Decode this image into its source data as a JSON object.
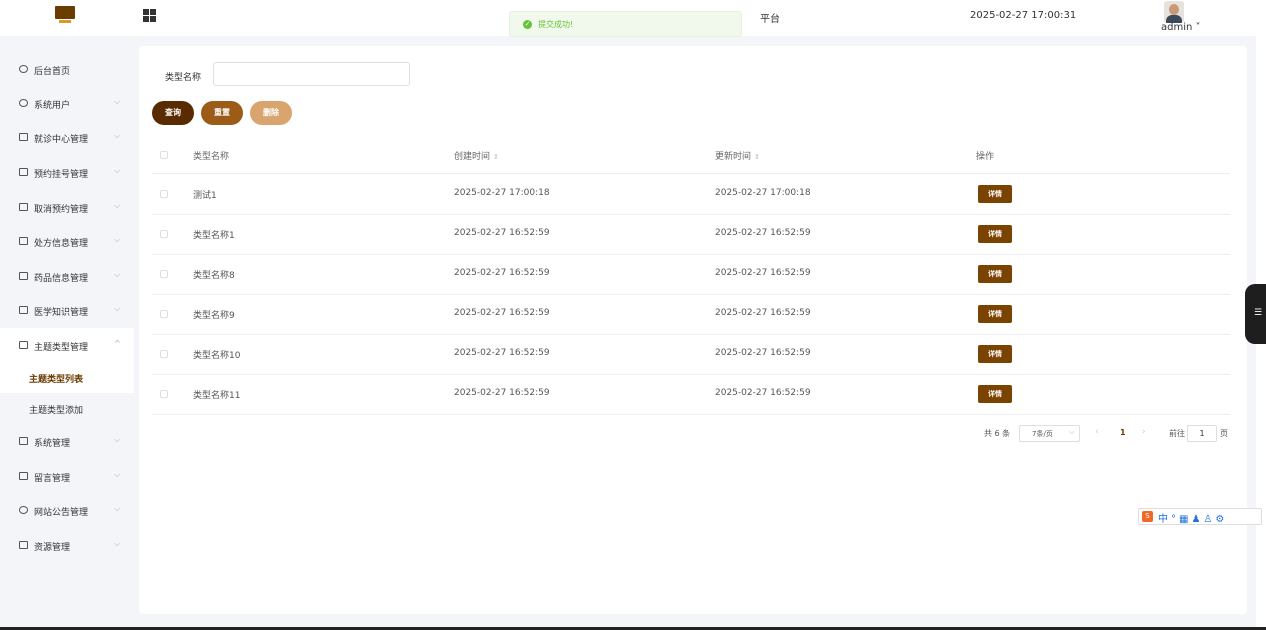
{
  "header": {
    "platform_title": "平台",
    "datetime": "2025-02-27 17:00:31",
    "user": "admin ˅"
  },
  "toast": {
    "message": "提交成功!"
  },
  "sidebar": {
    "items": [
      {
        "label": "后台首页",
        "icon": "clock-icon"
      },
      {
        "label": "系统用户",
        "icon": "user-icon"
      },
      {
        "label": "就诊中心管理",
        "icon": "folder-icon"
      },
      {
        "label": "预约挂号管理",
        "icon": "folder-icon"
      },
      {
        "label": "取消预约管理",
        "icon": "folder-icon"
      },
      {
        "label": "处方信息管理",
        "icon": "folder-icon"
      },
      {
        "label": "药品信息管理",
        "icon": "folder-icon"
      },
      {
        "label": "医学知识管理",
        "icon": "folder-icon"
      },
      {
        "label": "主题类型管理",
        "icon": "folder-icon"
      },
      {
        "label": "系统管理",
        "icon": "box-icon"
      },
      {
        "label": "留言管理",
        "icon": "box-icon"
      },
      {
        "label": "网站公告管理",
        "icon": "sun-icon"
      },
      {
        "label": "资源管理",
        "icon": "chest-icon"
      }
    ],
    "sub_items": [
      "主题类型列表",
      "主题类型添加"
    ]
  },
  "search": {
    "label": "类型名称",
    "value": ""
  },
  "buttons": {
    "query": "查询",
    "reset": "重置",
    "delete": "删除"
  },
  "table": {
    "columns": [
      "类型名称",
      "创建时间",
      "更新时间",
      "操作"
    ],
    "rows": [
      {
        "name": "测试1",
        "created": "2025-02-27 17:00:18",
        "updated": "2025-02-27 17:00:18"
      },
      {
        "name": "类型名称1",
        "created": "2025-02-27 16:52:59",
        "updated": "2025-02-27 16:52:59"
      },
      {
        "name": "类型名称8",
        "created": "2025-02-27 16:52:59",
        "updated": "2025-02-27 16:52:59"
      },
      {
        "name": "类型名称9",
        "created": "2025-02-27 16:52:59",
        "updated": "2025-02-27 16:52:59"
      },
      {
        "name": "类型名称10",
        "created": "2025-02-27 16:52:59",
        "updated": "2025-02-27 16:52:59"
      },
      {
        "name": "类型名称11",
        "created": "2025-02-27 16:52:59",
        "updated": "2025-02-27 16:52:59"
      }
    ],
    "action_label": "详情"
  },
  "pagination": {
    "total": "共 6 条",
    "page_size": "7条/页",
    "current": "1",
    "goto_label": "前往",
    "goto_value": "1",
    "page_suffix": "页"
  },
  "colors": {
    "accent": "#6b3c00",
    "success": "#67c23a"
  }
}
